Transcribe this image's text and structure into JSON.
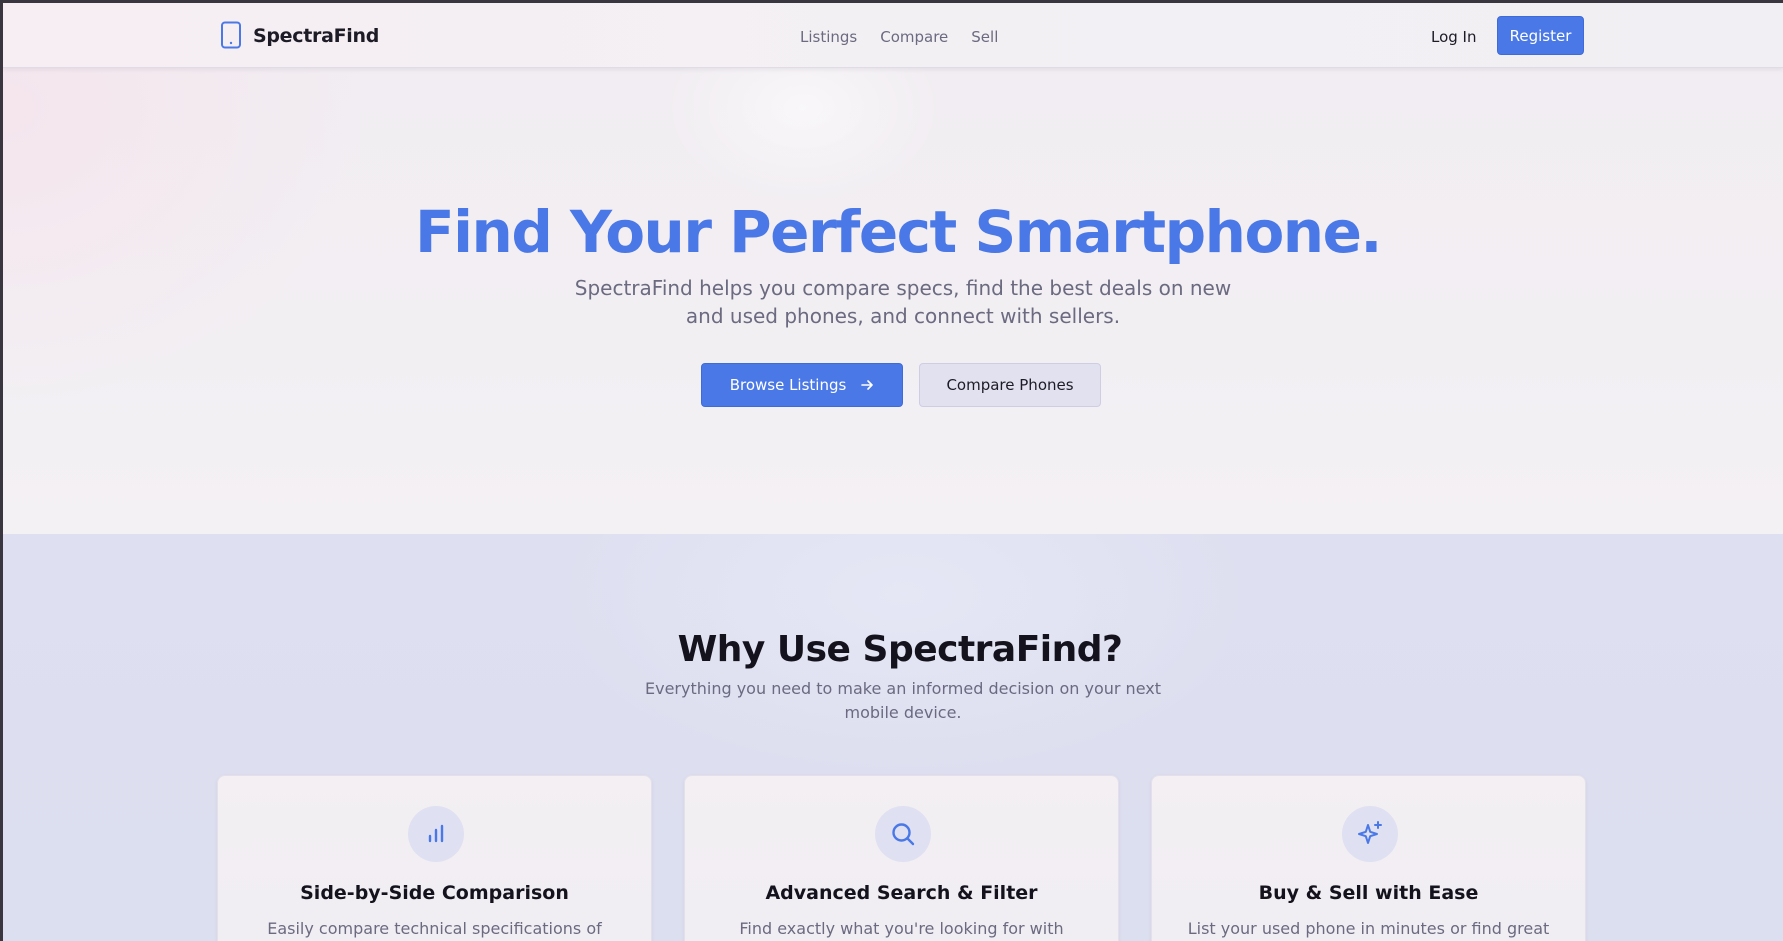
{
  "nav": {
    "brand": "SpectraFind",
    "links": [
      "Listings",
      "Compare",
      "Sell"
    ],
    "login": "Log In",
    "register": "Register"
  },
  "hero": {
    "title": "Find Your Perfect Smartphone.",
    "subtitle": "SpectraFind helps you compare specs, find the best deals on new and used phones, and connect with sellers.",
    "primary_button": "Browse Listings",
    "secondary_button": "Compare Phones"
  },
  "features": {
    "title": "Why Use SpectraFind?",
    "subtitle": "Everything you need to make an informed decision on your next mobile device.",
    "cards": [
      {
        "icon": "bar-chart-icon",
        "title": "Side-by-Side Comparison",
        "description": "Easily compare technical specifications of"
      },
      {
        "icon": "search-icon",
        "title": "Advanced Search & Filter",
        "description": "Find exactly what you're looking for with"
      },
      {
        "icon": "sparkles-icon",
        "title": "Buy & Sell with Ease",
        "description": "List your used phone in minutes or find great"
      }
    ]
  },
  "colors": {
    "accent": "#4a78e6",
    "text_dark": "#14121c",
    "text_muted": "#6b6a80"
  }
}
